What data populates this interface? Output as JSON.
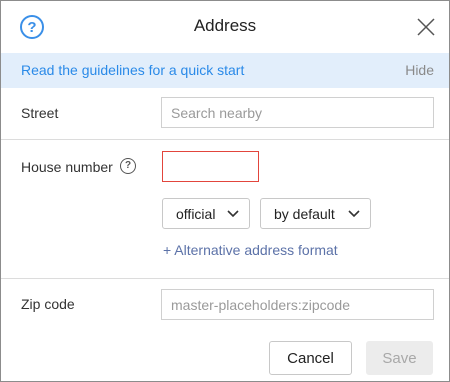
{
  "dialog": {
    "title": "Address",
    "help_icon": "question-circle-icon",
    "close_icon": "close-icon"
  },
  "banner": {
    "link_text": "Read the guidelines for a quick start",
    "hide_label": "Hide"
  },
  "street": {
    "label": "Street",
    "placeholder": "Search nearby",
    "value": ""
  },
  "house": {
    "label": "House number",
    "info_icon": "question-circle-icon",
    "value": "",
    "error": true
  },
  "format": {
    "type_selected": "official",
    "order_selected": "by default",
    "alt_link": "+ Alternative address format"
  },
  "zip": {
    "label": "Zip code",
    "placeholder": "master-placeholders:zipcode",
    "value": ""
  },
  "footer": {
    "cancel_label": "Cancel",
    "save_label": "Save"
  },
  "colors": {
    "accent": "#3a8fe8",
    "banner_bg": "#e2eefb",
    "error": "#e2453c",
    "secondary_link": "#5c72a8"
  }
}
